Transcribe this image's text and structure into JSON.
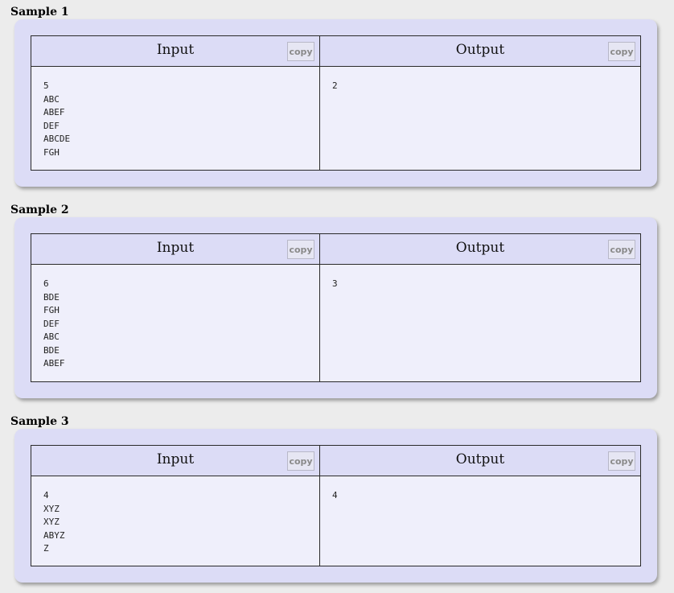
{
  "samples": [
    {
      "title": "Sample 1",
      "input_label": "Input",
      "output_label": "Output",
      "copy_label": "copy",
      "input_lines": [
        "5",
        "ABC",
        "ABEF",
        "DEF",
        "ABCDE",
        "FGH"
      ],
      "output_lines": [
        "2"
      ]
    },
    {
      "title": "Sample 2",
      "input_label": "Input",
      "output_label": "Output",
      "copy_label": "copy",
      "input_lines": [
        "6",
        "BDE",
        "FGH",
        "DEF",
        "ABC",
        "BDE",
        "ABEF"
      ],
      "output_lines": [
        "3"
      ]
    },
    {
      "title": "Sample 3",
      "input_label": "Input",
      "output_label": "Output",
      "copy_label": "copy",
      "input_lines": [
        "4",
        "XYZ",
        "XYZ",
        "ABYZ",
        "Z"
      ],
      "output_lines": [
        "4"
      ]
    }
  ]
}
